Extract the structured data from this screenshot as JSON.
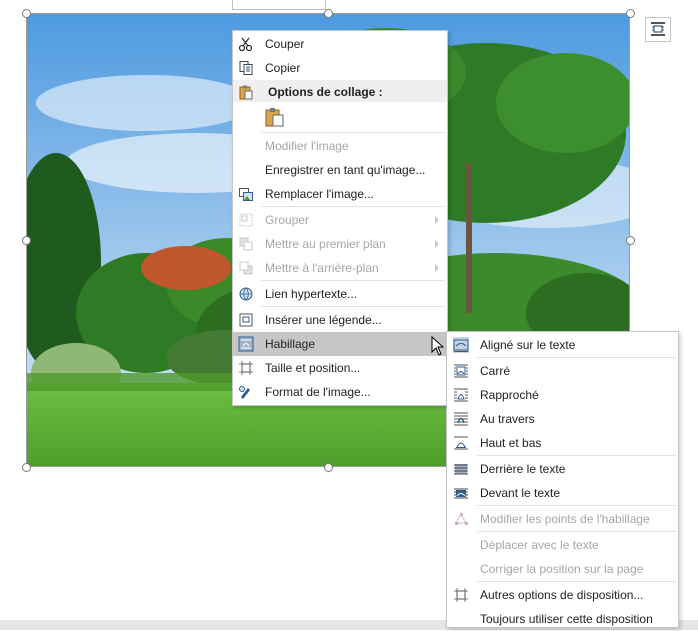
{
  "context_menu": {
    "items": [
      {
        "label": "Couper",
        "icon": "scissors-icon",
        "enabled": true
      },
      {
        "label": "Copier",
        "icon": "copy-icon",
        "enabled": true
      },
      {
        "label": "Options de collage :",
        "icon": "paste-icon",
        "enabled": true,
        "header": true
      },
      {
        "label": "Modifier l'image",
        "enabled": false
      },
      {
        "label": "Enregistrer en tant qu'image...",
        "enabled": true
      },
      {
        "label": "Remplacer l'image...",
        "icon": "change-picture-icon",
        "enabled": true
      },
      {
        "label": "Grouper",
        "icon": "group-icon",
        "enabled": false,
        "submenu": true
      },
      {
        "label": "Mettre au premier plan",
        "icon": "bring-forward-icon",
        "enabled": false,
        "submenu": true
      },
      {
        "label": "Mettre à l'arrière-plan",
        "icon": "send-backward-icon",
        "enabled": false,
        "submenu": true
      },
      {
        "label": "Lien hypertexte...",
        "icon": "hyperlink-icon",
        "enabled": true
      },
      {
        "label": "Insérer une légende...",
        "icon": "caption-icon",
        "enabled": true
      },
      {
        "label": "Habillage",
        "icon": "wrap-text-icon",
        "enabled": true,
        "submenu": true,
        "highlighted": true
      },
      {
        "label": "Taille et position...",
        "icon": "size-position-icon",
        "enabled": true
      },
      {
        "label": "Format de l'image...",
        "icon": "format-picture-icon",
        "enabled": true
      }
    ]
  },
  "wrap_submenu": {
    "items": [
      {
        "label": "Aligné sur le texte",
        "icon": "wrap-inline-icon",
        "enabled": true,
        "selected": true
      },
      {
        "label": "Carré",
        "icon": "wrap-square-icon",
        "enabled": true
      },
      {
        "label": "Rapproché",
        "icon": "wrap-tight-icon",
        "enabled": true
      },
      {
        "label": "Au travers",
        "icon": "wrap-through-icon",
        "enabled": true
      },
      {
        "label": "Haut et bas",
        "icon": "wrap-top-bottom-icon",
        "enabled": true
      },
      {
        "label": "Derrière le texte",
        "icon": "wrap-behind-icon",
        "enabled": true
      },
      {
        "label": "Devant le texte",
        "icon": "wrap-front-icon",
        "enabled": true
      },
      {
        "label": "Modifier les points de l'habillage",
        "icon": "edit-wrap-points-icon",
        "enabled": false
      },
      {
        "label": "Déplacer avec le texte",
        "enabled": false
      },
      {
        "label": "Corriger la position sur la page",
        "enabled": false
      },
      {
        "label": "Autres options de disposition...",
        "icon": "more-layout-icon",
        "enabled": true
      },
      {
        "label": "Toujours utiliser cette disposition",
        "enabled": true
      }
    ]
  },
  "colors": {
    "highlight": "#c6c6c6",
    "disabled_text": "#a6a6a6",
    "icon_blue": "#2f5c91",
    "sky": "#7fb6e6",
    "grass": "#5db33a"
  }
}
